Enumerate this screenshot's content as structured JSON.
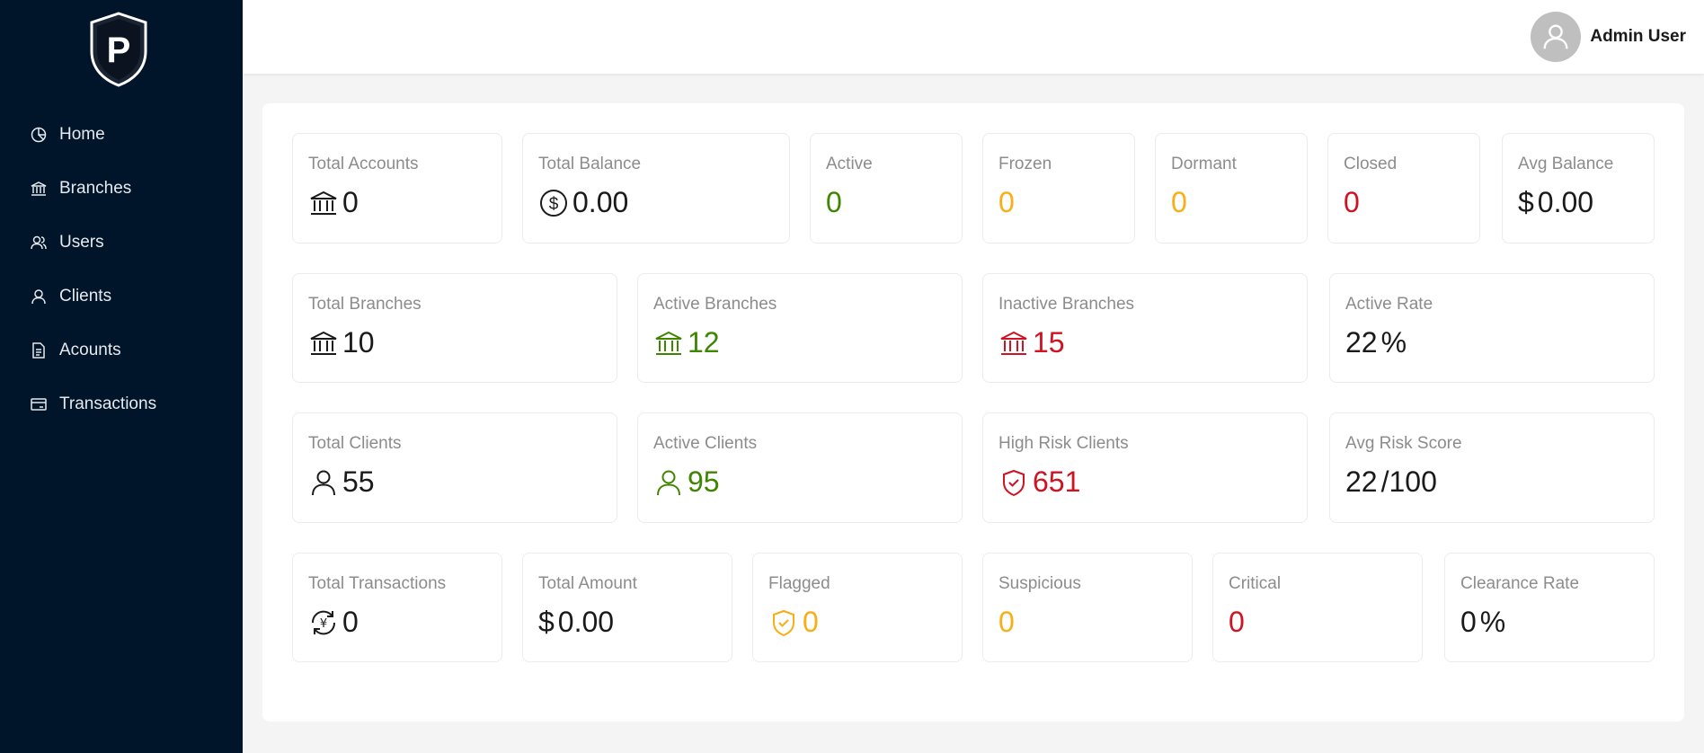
{
  "sidebar": {
    "logo_letter": "P",
    "items": [
      {
        "label": "Home",
        "icon": "pie-chart-icon"
      },
      {
        "label": "Branches",
        "icon": "bank-icon"
      },
      {
        "label": "Users",
        "icon": "users-icon"
      },
      {
        "label": "Clients",
        "icon": "user-icon"
      },
      {
        "label": "Acounts",
        "icon": "file-icon"
      },
      {
        "label": "Transactions",
        "icon": "credit-card-icon"
      }
    ]
  },
  "header": {
    "user_name": "Admin User"
  },
  "colors": {
    "sidebar_bg": "#001529",
    "green": "#3f8600",
    "orange": "#faad14",
    "red": "#cf1322"
  },
  "stats": {
    "accounts": {
      "total": {
        "label": "Total Accounts",
        "value": "0"
      },
      "balance": {
        "label": "Total Balance",
        "value": "0.00"
      },
      "active": {
        "label": "Active",
        "value": "0"
      },
      "frozen": {
        "label": "Frozen",
        "value": "0"
      },
      "dormant": {
        "label": "Dormant",
        "value": "0"
      },
      "closed": {
        "label": "Closed",
        "value": "0"
      },
      "avg_balance": {
        "label": "Avg Balance",
        "prefix": "$",
        "value": "0.00"
      }
    },
    "branches": {
      "total": {
        "label": "Total Branches",
        "value": "10"
      },
      "active": {
        "label": "Active Branches",
        "value": "12"
      },
      "inactive": {
        "label": "Inactive Branches",
        "value": "15"
      },
      "rate": {
        "label": "Active Rate",
        "value": "22",
        "suffix": "%"
      }
    },
    "clients": {
      "total": {
        "label": "Total Clients",
        "value": "55"
      },
      "active": {
        "label": "Active Clients",
        "value": "95"
      },
      "high_risk": {
        "label": "High Risk Clients",
        "value": "651"
      },
      "avg_risk": {
        "label": "Avg Risk Score",
        "value": "22",
        "suffix": "/100"
      }
    },
    "transactions": {
      "total": {
        "label": "Total Transactions",
        "value": "0"
      },
      "amount": {
        "label": "Total Amount",
        "prefix": "$",
        "value": "0.00"
      },
      "flagged": {
        "label": "Flagged",
        "value": "0"
      },
      "suspicious": {
        "label": "Suspicious",
        "value": "0"
      },
      "critical": {
        "label": "Critical",
        "value": "0"
      },
      "clearance": {
        "label": "Clearance Rate",
        "value": "0",
        "suffix": "%"
      }
    }
  }
}
